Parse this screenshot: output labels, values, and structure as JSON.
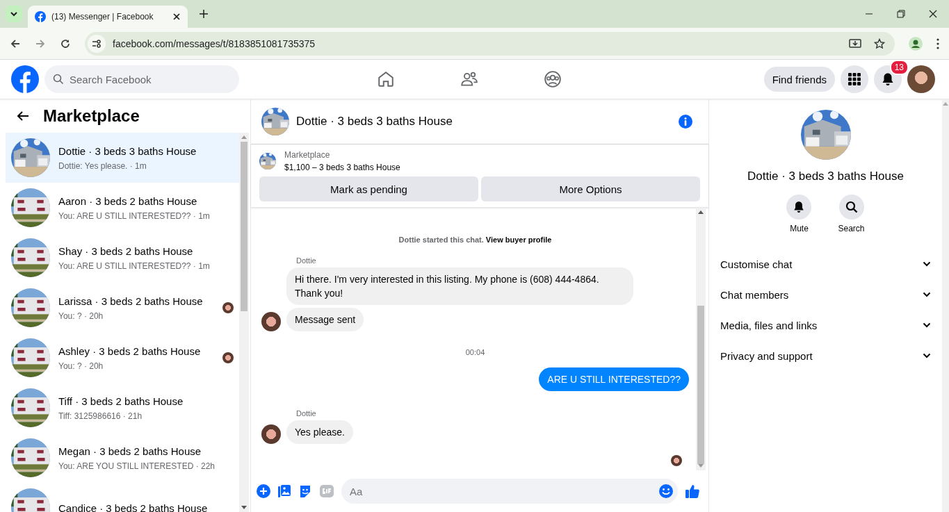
{
  "browser": {
    "tab_title": "(13) Messenger | Facebook",
    "url": "facebook.com/messages/t/8183851081735375"
  },
  "topbar": {
    "search_placeholder": "Search Facebook",
    "find_friends": "Find friends",
    "notification_count": "13"
  },
  "sidebar": {
    "title": "Marketplace",
    "conversations": [
      {
        "title": "Dottie · 3 beds 3 baths House",
        "preview": "Dottie: Yes please. · 1m",
        "selected": true,
        "seen": false
      },
      {
        "title": "Aaron · 3 beds 2 baths House",
        "preview": "You: ARE U STILL INTERESTED?? · 1m",
        "selected": false,
        "seen": false
      },
      {
        "title": "Shay · 3 beds 2 baths House",
        "preview": "You: ARE U STILL INTERESTED?? · 1m",
        "selected": false,
        "seen": false
      },
      {
        "title": "Larissa · 3 beds 2 baths House",
        "preview": "You: ? · 20h",
        "selected": false,
        "seen": true
      },
      {
        "title": "Ashley · 3 beds 2 baths House",
        "preview": "You: ? · 20h",
        "selected": false,
        "seen": true
      },
      {
        "title": "Tiff · 3 beds 2 baths House",
        "preview": "Tiff: 3125986616 · 21h",
        "selected": false,
        "seen": false
      },
      {
        "title": "Megan · 3 beds 2 baths House",
        "preview": "You: ARE YOU STILL INTERESTED · 22h",
        "selected": false,
        "seen": false
      },
      {
        "title": "Candice · 3 beds 2 baths House",
        "selected": false,
        "seen": false
      }
    ]
  },
  "chat": {
    "title": "Dottie · 3 beds 3 baths House",
    "listing": {
      "label": "Marketplace",
      "price_line": "$1,100 – 3 beds 3 baths House"
    },
    "buttons": [
      "Mark as pending",
      "More Options"
    ],
    "note": {
      "text": "Dottie started this chat.",
      "link": "View buyer profile"
    },
    "items": [
      {
        "kind": "sender",
        "text": "Dottie"
      },
      {
        "kind": "incoming",
        "text": "Hi there. I'm very interested in this listing. My phone is (608) 444-4864. Thank you!",
        "avatar": false
      },
      {
        "kind": "incoming",
        "text": "Message sent",
        "avatar": true
      },
      {
        "kind": "time",
        "text": "00:04"
      },
      {
        "kind": "outgoing",
        "text": "ARE U STILL INTERESTED??"
      },
      {
        "kind": "sender",
        "text": "Dottie"
      },
      {
        "kind": "incoming",
        "text": "Yes please.",
        "avatar": true
      }
    ],
    "seen": true,
    "composer_placeholder": "Aa"
  },
  "details": {
    "title": "Dottie · 3 beds 3 baths House",
    "actions": [
      {
        "kind": "bell",
        "label": "Mute"
      },
      {
        "kind": "search",
        "label": "Search"
      }
    ],
    "sections": [
      "Customise chat",
      "Chat members",
      "Media, files and links",
      "Privacy and support"
    ]
  }
}
